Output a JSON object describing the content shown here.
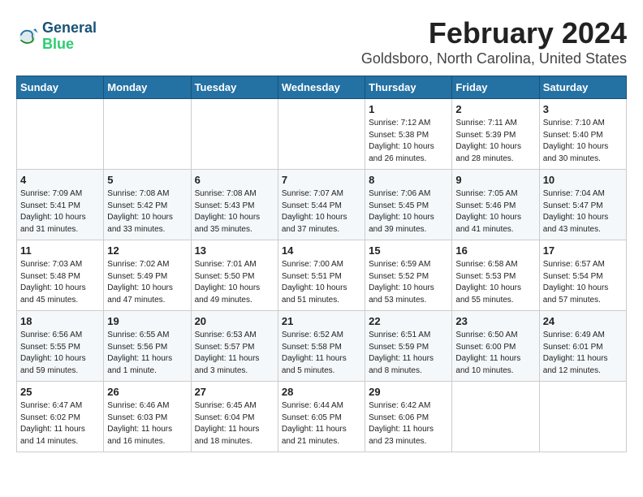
{
  "logo": {
    "line1": "General",
    "line2": "Blue"
  },
  "title": "February 2024",
  "subtitle": "Goldsboro, North Carolina, United States",
  "days_of_week": [
    "Sunday",
    "Monday",
    "Tuesday",
    "Wednesday",
    "Thursday",
    "Friday",
    "Saturday"
  ],
  "weeks": [
    [
      {
        "day": "",
        "info": ""
      },
      {
        "day": "",
        "info": ""
      },
      {
        "day": "",
        "info": ""
      },
      {
        "day": "",
        "info": ""
      },
      {
        "day": "1",
        "info": "Sunrise: 7:12 AM\nSunset: 5:38 PM\nDaylight: 10 hours\nand 26 minutes."
      },
      {
        "day": "2",
        "info": "Sunrise: 7:11 AM\nSunset: 5:39 PM\nDaylight: 10 hours\nand 28 minutes."
      },
      {
        "day": "3",
        "info": "Sunrise: 7:10 AM\nSunset: 5:40 PM\nDaylight: 10 hours\nand 30 minutes."
      }
    ],
    [
      {
        "day": "4",
        "info": "Sunrise: 7:09 AM\nSunset: 5:41 PM\nDaylight: 10 hours\nand 31 minutes."
      },
      {
        "day": "5",
        "info": "Sunrise: 7:08 AM\nSunset: 5:42 PM\nDaylight: 10 hours\nand 33 minutes."
      },
      {
        "day": "6",
        "info": "Sunrise: 7:08 AM\nSunset: 5:43 PM\nDaylight: 10 hours\nand 35 minutes."
      },
      {
        "day": "7",
        "info": "Sunrise: 7:07 AM\nSunset: 5:44 PM\nDaylight: 10 hours\nand 37 minutes."
      },
      {
        "day": "8",
        "info": "Sunrise: 7:06 AM\nSunset: 5:45 PM\nDaylight: 10 hours\nand 39 minutes."
      },
      {
        "day": "9",
        "info": "Sunrise: 7:05 AM\nSunset: 5:46 PM\nDaylight: 10 hours\nand 41 minutes."
      },
      {
        "day": "10",
        "info": "Sunrise: 7:04 AM\nSunset: 5:47 PM\nDaylight: 10 hours\nand 43 minutes."
      }
    ],
    [
      {
        "day": "11",
        "info": "Sunrise: 7:03 AM\nSunset: 5:48 PM\nDaylight: 10 hours\nand 45 minutes."
      },
      {
        "day": "12",
        "info": "Sunrise: 7:02 AM\nSunset: 5:49 PM\nDaylight: 10 hours\nand 47 minutes."
      },
      {
        "day": "13",
        "info": "Sunrise: 7:01 AM\nSunset: 5:50 PM\nDaylight: 10 hours\nand 49 minutes."
      },
      {
        "day": "14",
        "info": "Sunrise: 7:00 AM\nSunset: 5:51 PM\nDaylight: 10 hours\nand 51 minutes."
      },
      {
        "day": "15",
        "info": "Sunrise: 6:59 AM\nSunset: 5:52 PM\nDaylight: 10 hours\nand 53 minutes."
      },
      {
        "day": "16",
        "info": "Sunrise: 6:58 AM\nSunset: 5:53 PM\nDaylight: 10 hours\nand 55 minutes."
      },
      {
        "day": "17",
        "info": "Sunrise: 6:57 AM\nSunset: 5:54 PM\nDaylight: 10 hours\nand 57 minutes."
      }
    ],
    [
      {
        "day": "18",
        "info": "Sunrise: 6:56 AM\nSunset: 5:55 PM\nDaylight: 10 hours\nand 59 minutes."
      },
      {
        "day": "19",
        "info": "Sunrise: 6:55 AM\nSunset: 5:56 PM\nDaylight: 11 hours\nand 1 minute."
      },
      {
        "day": "20",
        "info": "Sunrise: 6:53 AM\nSunset: 5:57 PM\nDaylight: 11 hours\nand 3 minutes."
      },
      {
        "day": "21",
        "info": "Sunrise: 6:52 AM\nSunset: 5:58 PM\nDaylight: 11 hours\nand 5 minutes."
      },
      {
        "day": "22",
        "info": "Sunrise: 6:51 AM\nSunset: 5:59 PM\nDaylight: 11 hours\nand 8 minutes."
      },
      {
        "day": "23",
        "info": "Sunrise: 6:50 AM\nSunset: 6:00 PM\nDaylight: 11 hours\nand 10 minutes."
      },
      {
        "day": "24",
        "info": "Sunrise: 6:49 AM\nSunset: 6:01 PM\nDaylight: 11 hours\nand 12 minutes."
      }
    ],
    [
      {
        "day": "25",
        "info": "Sunrise: 6:47 AM\nSunset: 6:02 PM\nDaylight: 11 hours\nand 14 minutes."
      },
      {
        "day": "26",
        "info": "Sunrise: 6:46 AM\nSunset: 6:03 PM\nDaylight: 11 hours\nand 16 minutes."
      },
      {
        "day": "27",
        "info": "Sunrise: 6:45 AM\nSunset: 6:04 PM\nDaylight: 11 hours\nand 18 minutes."
      },
      {
        "day": "28",
        "info": "Sunrise: 6:44 AM\nSunset: 6:05 PM\nDaylight: 11 hours\nand 21 minutes."
      },
      {
        "day": "29",
        "info": "Sunrise: 6:42 AM\nSunset: 6:06 PM\nDaylight: 11 hours\nand 23 minutes."
      },
      {
        "day": "",
        "info": ""
      },
      {
        "day": "",
        "info": ""
      }
    ]
  ]
}
